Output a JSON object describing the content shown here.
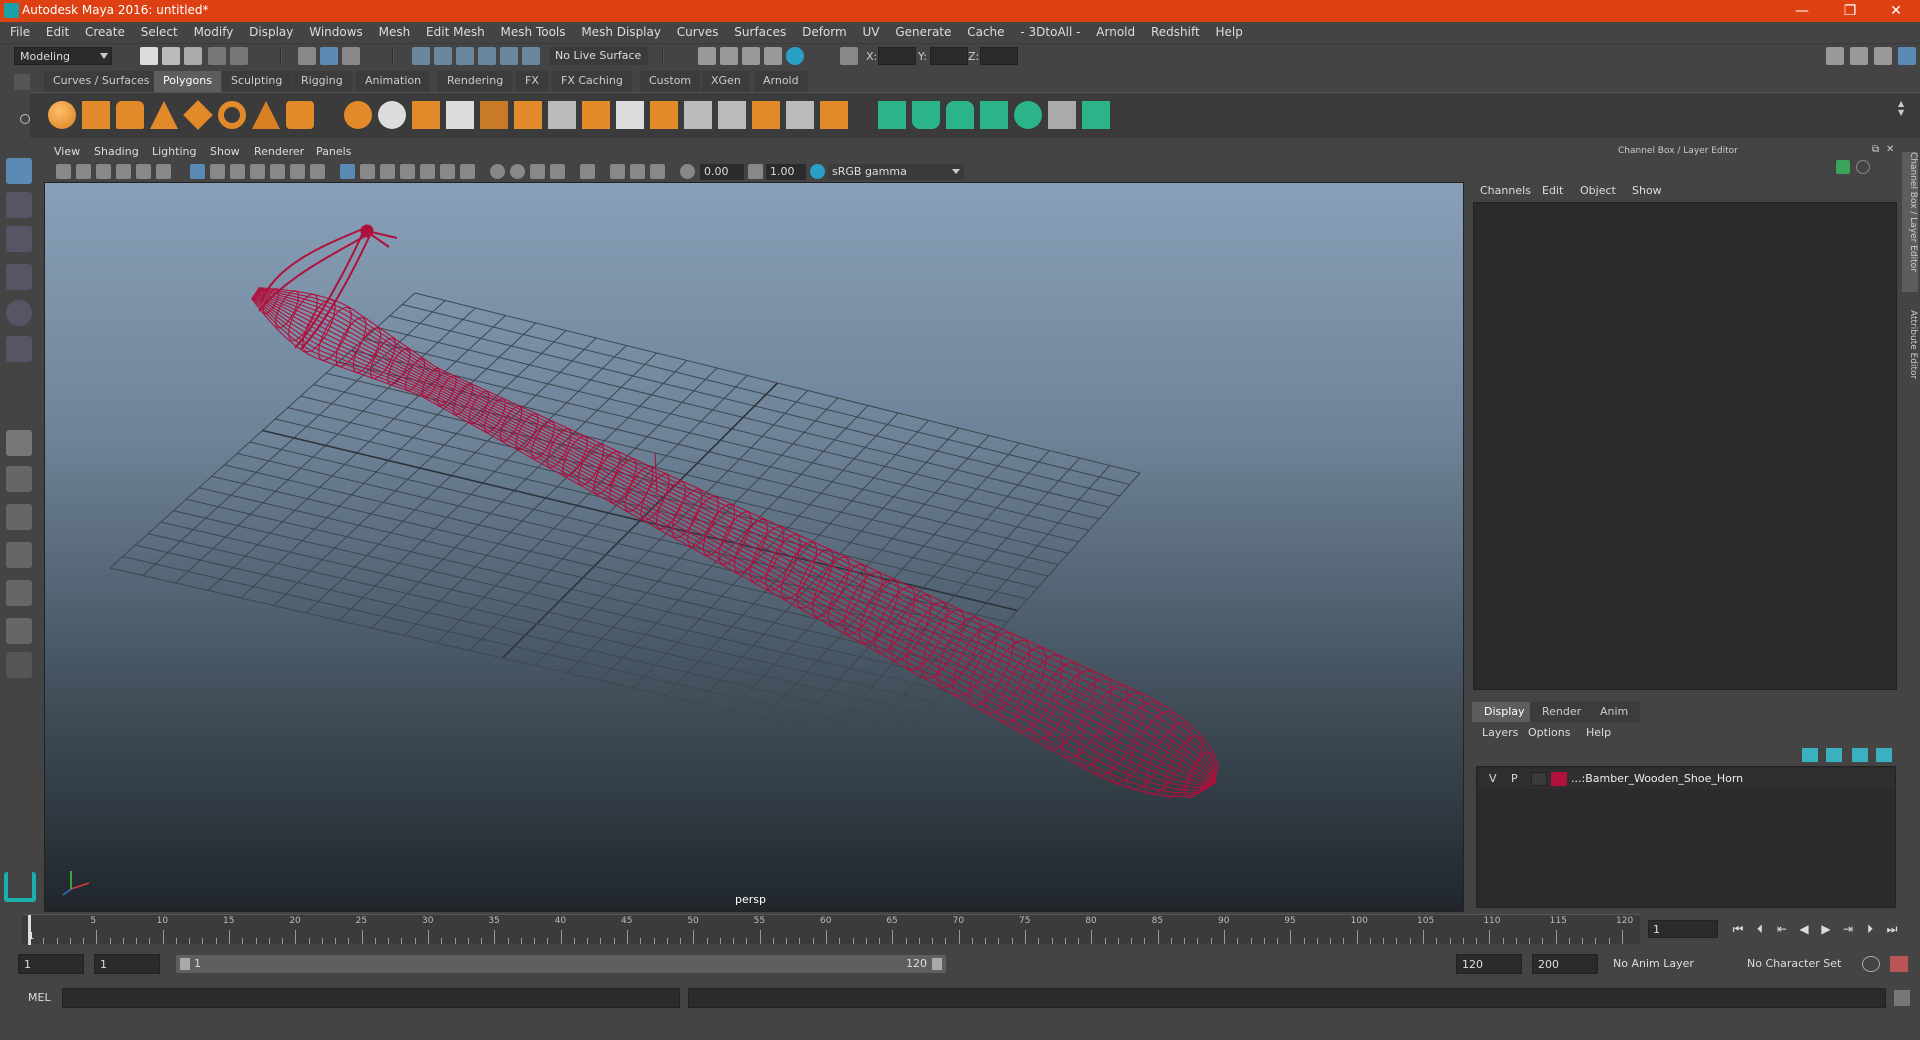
{
  "window": {
    "title": "Autodesk Maya 2016: untitled*",
    "minimize": "—",
    "maximize": "❐",
    "close": "✕"
  },
  "menubar": [
    "File",
    "Edit",
    "Create",
    "Select",
    "Modify",
    "Display",
    "Windows",
    "Mesh",
    "Edit Mesh",
    "Mesh Tools",
    "Mesh Display",
    "Curves",
    "Surfaces",
    "Deform",
    "UV",
    "Generate",
    "Cache",
    "- 3DtoAll -",
    "Arnold",
    "Redshift",
    "Help"
  ],
  "statusline": {
    "mode": "Modeling",
    "live_surface": "No Live Surface",
    "x_label": "X:",
    "y_label": "Y:",
    "z_label": "Z:"
  },
  "shelf_tabs": [
    "Curves / Surfaces",
    "Polygons",
    "Sculpting",
    "Rigging",
    "Animation",
    "Rendering",
    "FX",
    "FX Caching",
    "Custom",
    "XGen",
    "Arnold"
  ],
  "active_shelf": "Polygons",
  "viewport": {
    "menu": [
      "View",
      "Shading",
      "Lighting",
      "Show",
      "Renderer",
      "Panels"
    ],
    "exposure": "0.00",
    "gamma": "1.00",
    "colorspace": "sRGB gamma",
    "camera": "persp",
    "wire_color": "#b0103c"
  },
  "channel_box": {
    "title": "Channel Box / Layer Editor",
    "menu": [
      "Channels",
      "Edit",
      "Object",
      "Show"
    ]
  },
  "side_tabs": [
    "Channel Box / Layer Editor",
    "Attribute Editor"
  ],
  "layer_editor": {
    "tabs": [
      "Display",
      "Render",
      "Anim"
    ],
    "active_tab": "Display",
    "menu": [
      "Layers",
      "Options",
      "Help"
    ],
    "layers": [
      {
        "v": "V",
        "p": "P",
        "color": "#b0103c",
        "name": "...:Bamber_Wooden_Shoe_Horn"
      }
    ]
  },
  "timeline": {
    "ticks": [
      "5",
      "10",
      "15",
      "20",
      "25",
      "30",
      "35",
      "40",
      "45",
      "50",
      "55",
      "60",
      "65",
      "70",
      "75",
      "80",
      "85",
      "90",
      "95",
      "100",
      "105",
      "110",
      "115",
      "120"
    ],
    "start_label": "1",
    "current_frame": "1"
  },
  "range": {
    "start": "1",
    "anim_start": "1",
    "slider_start": "1",
    "slider_end": "120",
    "end": "120",
    "anim_end": "200",
    "anim_layer": "No Anim Layer",
    "character_set": "No Character Set"
  },
  "command": {
    "lang": "MEL"
  }
}
